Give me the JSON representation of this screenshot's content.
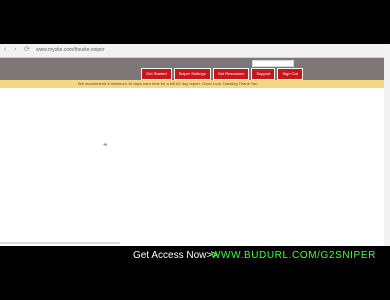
{
  "browser": {
    "url": "www.mysite.com/thesite-sniper",
    "back_icon": "chevron-left-icon",
    "forward_icon": "chevron-right-icon"
  },
  "toolbar": {
    "menu_items": [
      {
        "label": "Get Started"
      },
      {
        "label": "Sniper Settings"
      },
      {
        "label": "Get Resources"
      },
      {
        "label": "Support"
      },
      {
        "label": "Sign Out"
      }
    ]
  },
  "banner": {
    "text": "We recommend a minimum 10 days earn time for a full 60 day report.        Good Luck Tracking   Thank You"
  },
  "footer": {
    "cta_text": "Get Access Now>>",
    "cta_link": "WWW.BUDURL.COM/G2SNIPER"
  }
}
